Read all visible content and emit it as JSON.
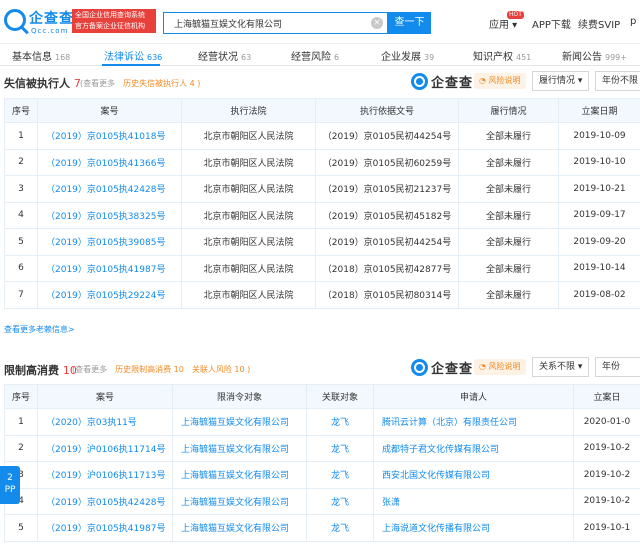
{
  "header": {
    "logo_cn": "企查查",
    "logo_en": "Qcc.com",
    "red_line1": "全国企业信用查询系统",
    "red_line2": "官方备案企业征信机构",
    "search_value": "上海毓猫互娱文化有限公司",
    "search_button": "查一下",
    "nav": {
      "apply": "应用",
      "hot": "HOT",
      "app_download": "APP下载",
      "svip": "续费SVIP",
      "user": "p"
    }
  },
  "tabs": [
    {
      "label": "基本信息",
      "count": "168"
    },
    {
      "label": "法律诉讼",
      "count": "636"
    },
    {
      "label": "经营状况",
      "count": "63"
    },
    {
      "label": "经营风险",
      "count": "6"
    },
    {
      "label": "企业发展",
      "count": "39"
    },
    {
      "label": "知识产权",
      "count": "451"
    },
    {
      "label": "新闻公告",
      "count": "999+"
    }
  ],
  "section1": {
    "title": "失信被执行人",
    "count": "7",
    "link_more": "(查看更多",
    "link_history": "历史失信被执行人 4 )",
    "watermark": "企查查",
    "risk_label": "风险说明",
    "select1": "履行情况",
    "select2": "年份不限",
    "columns": [
      "序号",
      "案号",
      "执行法院",
      "执行依据文号",
      "履行情况",
      "立案日期"
    ],
    "rows": [
      [
        "1",
        "（2019）京0105执41018号",
        "北京市朝阳区人民法院",
        "（2019）京0105民初44254号",
        "全部未履行",
        "2019-10-09"
      ],
      [
        "2",
        "（2019）京0105执41366号",
        "北京市朝阳区人民法院",
        "（2019）京0105民初60259号",
        "全部未履行",
        "2019-10-10"
      ],
      [
        "3",
        "（2019）京0105执42428号",
        "北京市朝阳区人民法院",
        "（2019）京0105民初21237号",
        "全部未履行",
        "2019-10-21"
      ],
      [
        "4",
        "（2019）京0105执38325号",
        "北京市朝阳区人民法院",
        "（2019）京0105民初45182号",
        "全部未履行",
        "2019-09-17"
      ],
      [
        "5",
        "（2019）京0105执39085号",
        "北京市朝阳区人民法院",
        "（2019）京0105民初44254号",
        "全部未履行",
        "2019-09-20"
      ],
      [
        "6",
        "（2019）京0105执41987号",
        "北京市朝阳区人民法院",
        "（2018）京0105民初42877号",
        "全部未履行",
        "2019-10-14"
      ],
      [
        "7",
        "（2019）京0105执29224号",
        "北京市朝阳区人民法院",
        "（2018）京0105民初80314号",
        "全部未履行",
        "2019-08-02"
      ]
    ],
    "more": "查看更多老赖信息>"
  },
  "section2": {
    "title": "限制高消费",
    "count": "10",
    "link_more": "(查看更多",
    "link_history": "历史限制高消费 10",
    "link_related": "关联人风险 10 )",
    "watermark": "企查查",
    "risk_label": "风险说明",
    "select1": "关系不限",
    "select2": "年份",
    "columns": [
      "序号",
      "案号",
      "限消令对象",
      "关联对象",
      "申请人",
      "立案日"
    ],
    "rows": [
      [
        "1",
        "（2020）京03执11号",
        "上海毓猫互娱文化有限公司",
        "龙飞",
        "腾讯云计算（北京）有限责任公司",
        "2020-01-0"
      ],
      [
        "2",
        "（2019）沪0106执11714号",
        "上海毓猫互娱文化有限公司",
        "龙飞",
        "成都特子君文化传媒有限公司",
        "2019-10-2"
      ],
      [
        "3",
        "（2019）沪0106执11713号",
        "上海毓猫互娱文化有限公司",
        "龙飞",
        "西安北国文化传媒有限公司",
        "2019-10-2"
      ],
      [
        "4",
        "（2019）京0105执42428号",
        "上海毓猫互娱文化有限公司",
        "龙飞",
        "张潇",
        "2019-10-2"
      ],
      [
        "5",
        "（2019）京0105执41987号",
        "上海毓猫互娱文化有限公司",
        "龙飞",
        "上海说道文化传播有限公司",
        "2019-10-1"
      ]
    ]
  },
  "side_float": {
    "line1": "2",
    "line2": "PP"
  }
}
